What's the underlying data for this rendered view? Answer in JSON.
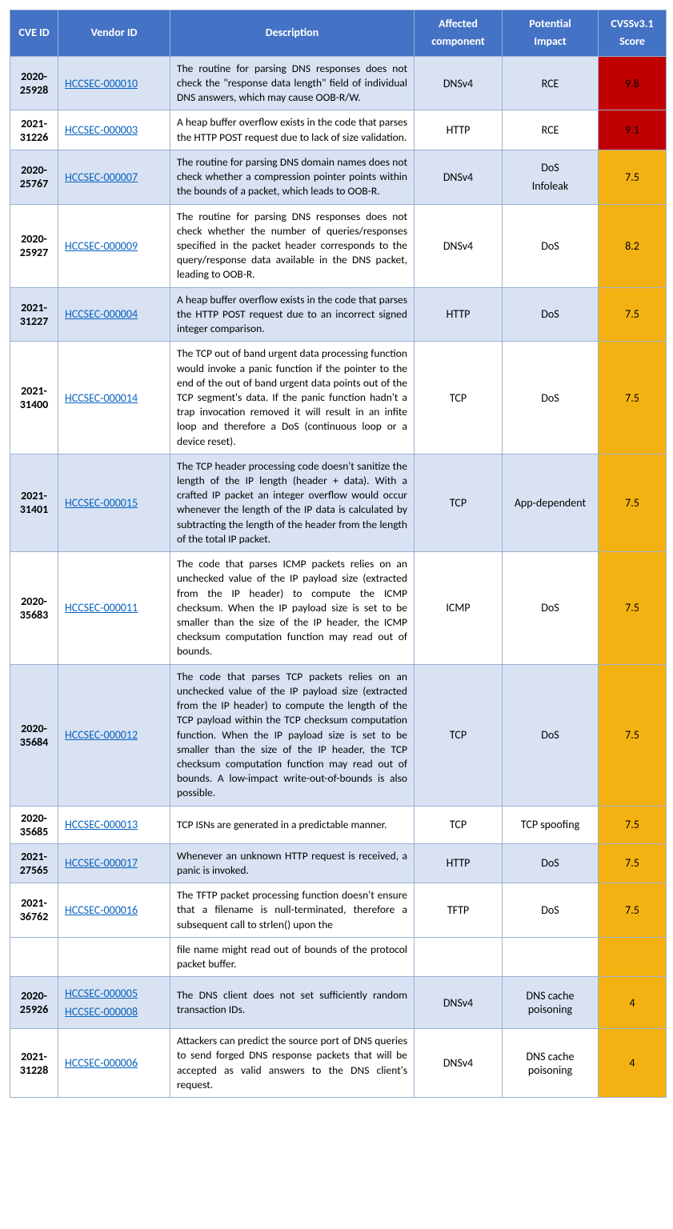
{
  "headers": {
    "cve": "CVE ID",
    "vendor": "Vendor ID",
    "desc": "Description",
    "comp_line1": "Affected",
    "comp_line2": "component",
    "impact_line1": "Potential",
    "impact_line2": "Impact",
    "score_line1": "CVSSv3.1",
    "score_line2": "Score"
  },
  "rows": [
    {
      "cve": "2020-25928",
      "vendors": [
        "HCCSEC-000010"
      ],
      "desc": "The routine for parsing DNS responses does not check the \"response data length\" field of individual DNS answers, which may cause OOB-R/W.",
      "component": "DNSv4",
      "impact": "RCE",
      "score": "9.8",
      "score_class": "critical",
      "shade": "odd"
    },
    {
      "cve": "2021-31226",
      "vendors": [
        "HCCSEC-000003"
      ],
      "desc": "A heap buffer overflow exists in the code that parses the HTTP POST request due to lack of size validation.",
      "component": "HTTP",
      "impact": "RCE",
      "score": "9.1",
      "score_class": "critical",
      "shade": "even"
    },
    {
      "cve": "2020-25767",
      "vendors": [
        "HCCSEC-000007"
      ],
      "desc": "The routine for parsing DNS domain names does not check whether a compression pointer points within the bounds of a packet, which leads to OOB-R.",
      "component": "DNSv4",
      "impact_lines": [
        "DoS",
        "Infoleak"
      ],
      "score": "7.5",
      "score_class": "high",
      "shade": "odd"
    },
    {
      "cve": "2020-25927",
      "vendors": [
        "HCCSEC-000009"
      ],
      "desc": "The routine for parsing DNS responses does not check whether the number of queries/responses specified in the packet header corresponds to the query/response data available in the DNS packet, leading to OOB-R.",
      "component": "DNSv4",
      "impact": "DoS",
      "score": "8.2",
      "score_class": "high",
      "shade": "even"
    },
    {
      "cve": "2021-31227",
      "vendors": [
        "HCCSEC-000004"
      ],
      "desc": "A heap buffer overflow exists in the code that parses the HTTP POST request due to an incorrect signed integer comparison.",
      "component": "HTTP",
      "impact": "DoS",
      "score": "7.5",
      "score_class": "high",
      "shade": "odd"
    },
    {
      "cve": "2021-31400",
      "vendors": [
        "HCCSEC-000014"
      ],
      "desc": "The TCP out of band urgent data processing function would invoke a panic function if the pointer to the end of the out of band urgent data points out of the TCP segment's data. If the panic function hadn't a trap invocation removed it will result in an infite loop and therefore a DoS (continuous loop or a device reset).",
      "component": "TCP",
      "impact": "DoS",
      "score": "7.5",
      "score_class": "high",
      "shade": "even"
    },
    {
      "cve": "2021-31401",
      "vendors": [
        "HCCSEC-000015"
      ],
      "desc": "The TCP header processing code doesn't sanitize the length of the IP length (header + data). With a crafted IP packet an integer overflow would occur whenever the length of the IP data is calculated by subtracting the length of the header from the length of the total IP packet.",
      "component": "TCP",
      "impact": "App-dependent",
      "score": "7.5",
      "score_class": "high",
      "shade": "odd"
    },
    {
      "cve": "2020-35683",
      "vendors": [
        "HCCSEC-000011"
      ],
      "desc": "The code that parses ICMP packets relies on an unchecked value of the IP payload size (extracted from the IP header) to compute the ICMP checksum. When the IP payload size is set to be smaller than the size of the IP header, the ICMP checksum computation function may read out of bounds.",
      "component": "ICMP",
      "impact": "DoS",
      "score": "7.5",
      "score_class": "high",
      "shade": "even"
    },
    {
      "cve": "2020-35684",
      "vendors": [
        "HCCSEC-000012"
      ],
      "desc": "The code that parses TCP packets relies on an unchecked value of the IP payload size (extracted from the IP header) to compute the length of the TCP payload within the TCP checksum computation function. When the IP payload size is set to be smaller than the size of the IP header, the TCP checksum computation function may read out of bounds. A low-impact write-out-of-bounds is also possible.",
      "component": "TCP",
      "impact": "DoS",
      "score": "7.5",
      "score_class": "high",
      "shade": "odd"
    },
    {
      "cve": "2020-35685",
      "vendors": [
        "HCCSEC-000013"
      ],
      "desc": "TCP ISNs are generated in a predictable manner.",
      "component": "TCP",
      "impact": "TCP spoofing",
      "score": "7.5",
      "score_class": "high",
      "shade": "even"
    },
    {
      "cve": "2021-27565",
      "vendors": [
        "HCCSEC-000017"
      ],
      "desc": "Whenever an unknown HTTP request is received, a panic is invoked.",
      "component": "HTTP",
      "impact": "DoS",
      "score": "7.5",
      "score_class": "high",
      "shade": "odd"
    },
    {
      "cve": "2021-36762",
      "vendors": [
        "HCCSEC-000016"
      ],
      "desc_part1": "The TFTP packet processing function doesn't ensure that a filename is null-terminated, therefore a subsequent call to strlen() upon the",
      "desc_part2": "file name might read out of bounds of the protocol packet buffer.",
      "component": "TFTP",
      "impact": "DoS",
      "score": "7.5",
      "score_class": "high",
      "shade": "even",
      "split": true
    },
    {
      "cve": "2020-25926",
      "vendors": [
        "HCCSEC-000005",
        "HCCSEC-000008"
      ],
      "desc": "The DNS client does not set sufficiently random transaction IDs.",
      "component": "DNSv4",
      "impact": "DNS cache poisoning",
      "score": "4",
      "score_class": "high",
      "shade": "odd"
    },
    {
      "cve": "2021-31228",
      "vendors": [
        "HCCSEC-000006"
      ],
      "desc": "Attackers can predict the source port of DNS queries to send forged DNS response packets that will be accepted as valid answers to the DNS client's request.",
      "component": "DNSv4",
      "impact": "DNS cache poisoning",
      "score": "4",
      "score_class": "high",
      "shade": "even"
    }
  ]
}
